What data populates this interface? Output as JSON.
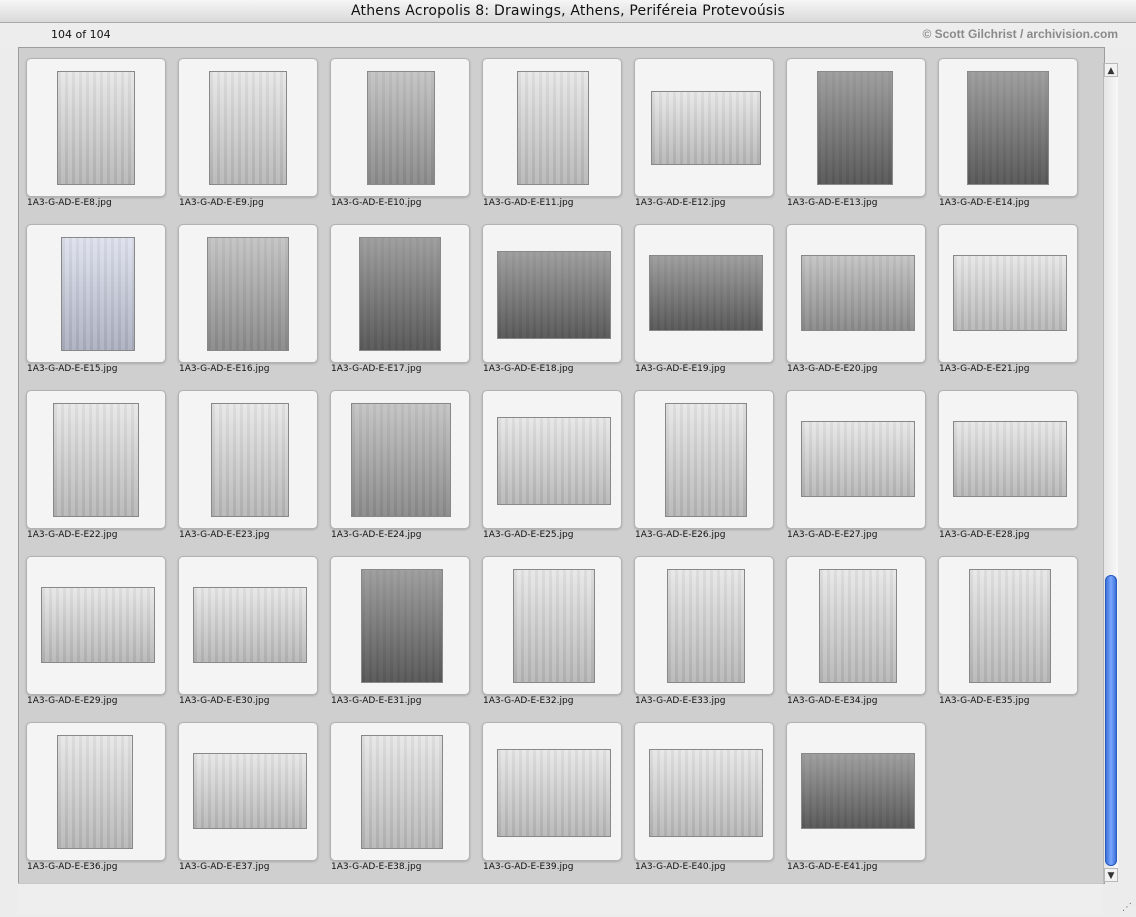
{
  "window": {
    "title": "Athens Acropolis 8: Drawings, Athens, Periféreia Protevoúsis"
  },
  "header": {
    "count": "104 of 104",
    "credit": "© Scott Gilchrist / archivision.com"
  },
  "thumbnails": [
    {
      "file": "1A3-G-AD-E-E8.jpg"
    },
    {
      "file": "1A3-G-AD-E-E9.jpg"
    },
    {
      "file": "1A3-G-AD-E-E10.jpg"
    },
    {
      "file": "1A3-G-AD-E-E11.jpg"
    },
    {
      "file": "1A3-G-AD-E-E12.jpg"
    },
    {
      "file": "1A3-G-AD-E-E13.jpg"
    },
    {
      "file": "1A3-G-AD-E-E14.jpg"
    },
    {
      "file": "1A3-G-AD-E-E15.jpg"
    },
    {
      "file": "1A3-G-AD-E-E16.jpg"
    },
    {
      "file": "1A3-G-AD-E-E17.jpg"
    },
    {
      "file": "1A3-G-AD-E-E18.jpg"
    },
    {
      "file": "1A3-G-AD-E-E19.jpg"
    },
    {
      "file": "1A3-G-AD-E-E20.jpg"
    },
    {
      "file": "1A3-G-AD-E-E21.jpg"
    },
    {
      "file": "1A3-G-AD-E-E22.jpg"
    },
    {
      "file": "1A3-G-AD-E-E23.jpg"
    },
    {
      "file": "1A3-G-AD-E-E24.jpg"
    },
    {
      "file": "1A3-G-AD-E-E25.jpg"
    },
    {
      "file": "1A3-G-AD-E-E26.jpg"
    },
    {
      "file": "1A3-G-AD-E-E27.jpg"
    },
    {
      "file": "1A3-G-AD-E-E28.jpg"
    },
    {
      "file": "1A3-G-AD-E-E29.jpg"
    },
    {
      "file": "1A3-G-AD-E-E30.jpg"
    },
    {
      "file": "1A3-G-AD-E-E31.jpg"
    },
    {
      "file": "1A3-G-AD-E-E32.jpg"
    },
    {
      "file": "1A3-G-AD-E-E33.jpg"
    },
    {
      "file": "1A3-G-AD-E-E34.jpg"
    },
    {
      "file": "1A3-G-AD-E-E35.jpg"
    },
    {
      "file": "1A3-G-AD-E-E36.jpg"
    },
    {
      "file": "1A3-G-AD-E-E37.jpg"
    },
    {
      "file": "1A3-G-AD-E-E38.jpg"
    },
    {
      "file": "1A3-G-AD-E-E39.jpg"
    },
    {
      "file": "1A3-G-AD-E-E40.jpg"
    },
    {
      "file": "1A3-G-AD-E-E41.jpg"
    }
  ],
  "scroll": {
    "up_arrow": "▲",
    "down_arrow": "▼",
    "resize_grip": "⋰"
  }
}
